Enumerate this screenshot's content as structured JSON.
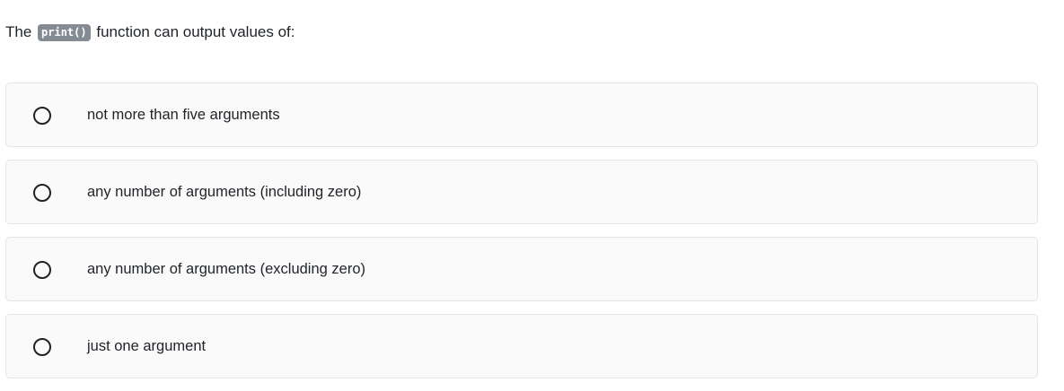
{
  "question": {
    "prefix": "The",
    "code": "print()",
    "suffix": "function can output values of:"
  },
  "options": [
    {
      "label": "not more than five arguments",
      "selected": false
    },
    {
      "label": "any number of arguments (including zero)",
      "selected": false
    },
    {
      "label": "any number of arguments (excluding zero)",
      "selected": false
    },
    {
      "label": "just one argument",
      "selected": false
    }
  ]
}
